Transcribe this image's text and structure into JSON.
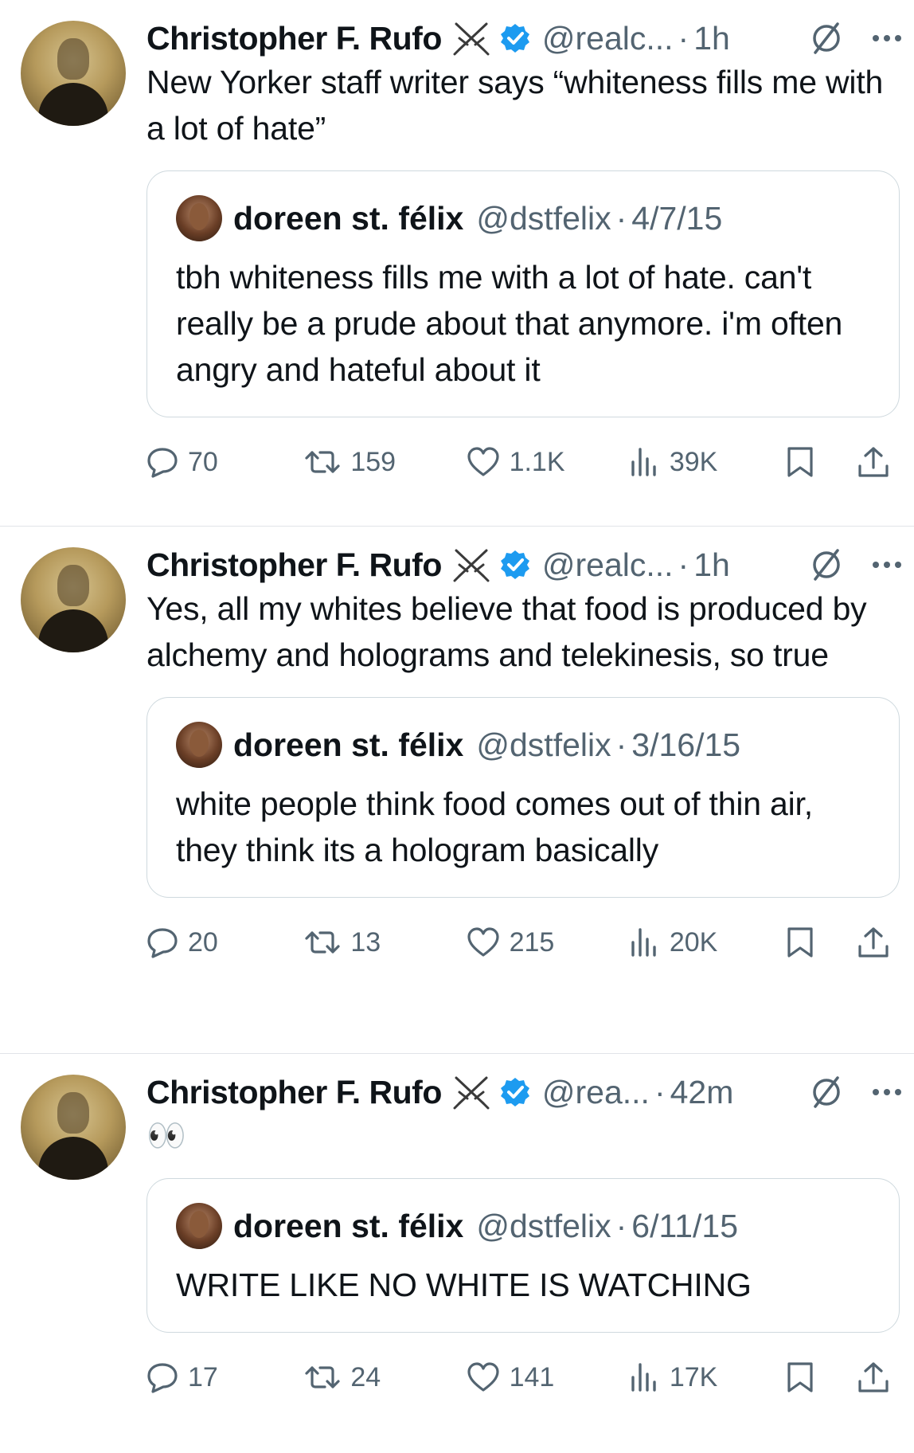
{
  "tweets": [
    {
      "author_name": "Christopher F. Rufo",
      "handle": "@realc...",
      "separator": "·",
      "time": "1h",
      "text": "New Yorker staff writer says “whiteness fills me with a lot of hate”",
      "quote": {
        "author_name": "doreen st. félix",
        "handle": "@dstfelix",
        "separator": "·",
        "date": "4/7/15",
        "text": "tbh whiteness fills me with a lot of hate. can't really be a prude about that anymore. i'm often angry and hateful about it"
      },
      "stats": {
        "replies": "70",
        "retweets": "159",
        "likes": "1.1K",
        "views": "39K"
      }
    },
    {
      "author_name": "Christopher F. Rufo",
      "handle": "@realc...",
      "separator": "·",
      "time": "1h",
      "text": "Yes, all my whites believe that food is produced by alchemy and holograms and telekinesis, so true",
      "quote": {
        "author_name": "doreen st. félix",
        "handle": "@dstfelix",
        "separator": "·",
        "date": "3/16/15",
        "text": "white people think food comes out of thin air, they think its a hologram basically"
      },
      "stats": {
        "replies": "20",
        "retweets": "13",
        "likes": "215",
        "views": "20K"
      }
    },
    {
      "author_name": "Christopher F. Rufo",
      "handle": "@rea...",
      "separator": "·",
      "time": "42m",
      "text": "👀",
      "quote": {
        "author_name": "doreen st. félix",
        "handle": "@dstfelix",
        "separator": "·",
        "date": "6/11/15",
        "text": "WRITE LIKE NO WHITE IS WATCHING"
      },
      "stats": {
        "replies": "17",
        "retweets": "24",
        "likes": "141",
        "views": "17K"
      }
    }
  ],
  "icons": {
    "name_badge": "crossed-swords-icon",
    "verified": "verified-badge-icon",
    "grok": "grok-icon",
    "more": "more-dots-icon",
    "reply": "reply-icon",
    "retweet": "retweet-icon",
    "like": "heart-icon",
    "views": "views-icon",
    "bookmark": "bookmark-icon",
    "share": "share-icon"
  },
  "colors": {
    "verified": "#1d9bf0",
    "muted": "#536471",
    "text": "#0f1419",
    "border": "#cfd9de"
  }
}
